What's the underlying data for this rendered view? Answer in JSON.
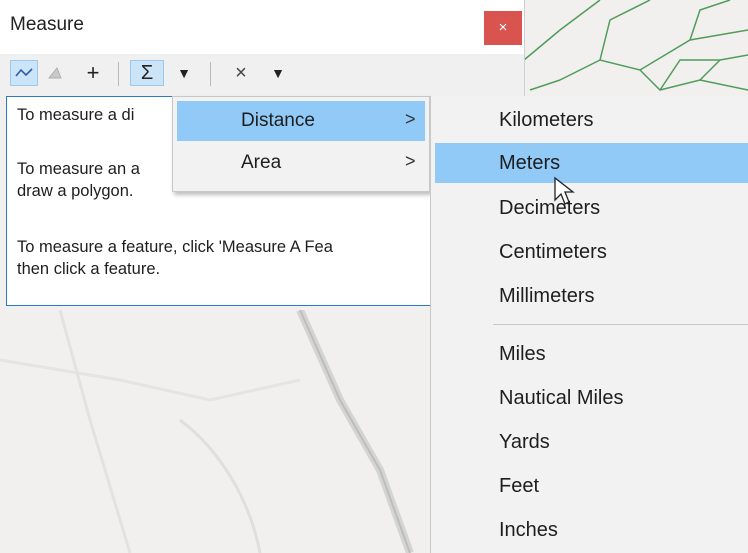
{
  "window": {
    "title": "Measure",
    "close_label": "×"
  },
  "toolbar": {
    "measure_line_icon": "line-icon",
    "measure_area_icon": "polygon-icon",
    "measure_feature_icon": "plus-icon",
    "sum_label": "Σ",
    "clear_label": "×",
    "dropdown_label": "▼"
  },
  "help": {
    "line1": "To measure a di",
    "line2": "To measure an a",
    "line3": "draw a polygon.",
    "line4": "To measure a feature, click 'Measure A Fea",
    "line5": "then click a feature."
  },
  "menu_type": {
    "items": [
      {
        "label": "Distance",
        "arrow": ">"
      },
      {
        "label": "Area",
        "arrow": ">"
      }
    ]
  },
  "menu_units": {
    "items": [
      {
        "label": "Kilometers"
      },
      {
        "label": "Meters"
      },
      {
        "label": "Decimeters"
      },
      {
        "label": "Centimeters"
      },
      {
        "label": "Millimeters"
      },
      {
        "label": "Miles"
      },
      {
        "label": "Nautical Miles"
      },
      {
        "label": "Yards"
      },
      {
        "label": "Feet"
      },
      {
        "label": "Inches"
      }
    ]
  },
  "colors": {
    "highlight": "#91c9f7",
    "close": "#d9534f",
    "focus_border": "#2a7ac7",
    "map_roads": "#2e8b57"
  }
}
